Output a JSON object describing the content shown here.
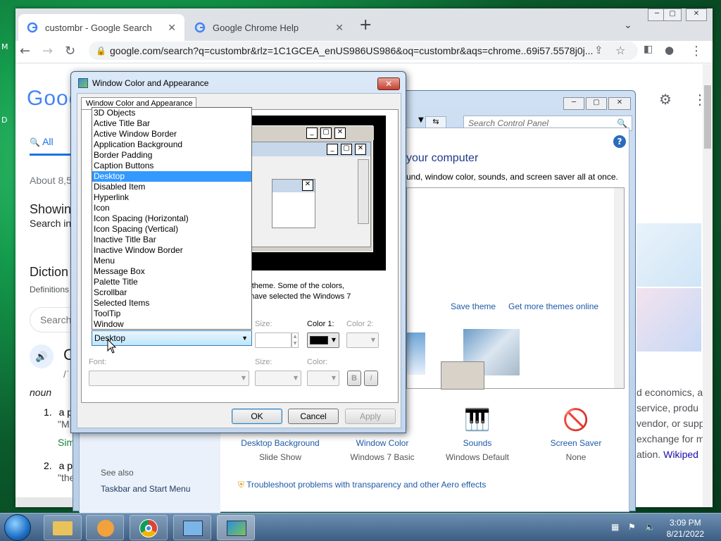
{
  "browser": {
    "tab1_title": "custombr - Google Search",
    "tab2_title": "Google Chrome Help",
    "url": "google.com/search?q=custombr&rlz=1C1GCEA_enUS986US986&oq=custombr&aqs=chrome..69i57.5578j0j...",
    "google": {
      "logo": "Goog",
      "all_tab": "All",
      "about": "About 8,5",
      "showing": "Showin",
      "search_in": "Search in",
      "dictionary": "Diction",
      "definitions": "Definitions",
      "search_box": "Search",
      "word_initial": "C",
      "pron": "/ˈ",
      "pos": "noun",
      "def1_num": "1.",
      "def1": "a p",
      "def1_quote": "\"M",
      "sim": "Sim",
      "def2_num": "2.",
      "def2": "a pe",
      "def2_quote": "\"the",
      "right_lines": [
        "d economics, a",
        "service, produ",
        "vendor, or supp",
        "exchange for m",
        "ation."
      ],
      "wiki": "Wikiped"
    }
  },
  "control_panel": {
    "search_placeholder": "Search Control Panel",
    "heading": "your computer",
    "subheading": "und, window color, sounds, and screen saver all at once.",
    "save_theme": "Save theme",
    "get_more": "Get more themes online",
    "see_also": "See also",
    "taskbar_link": "Taskbar and Start Menu",
    "tiles": [
      {
        "label": "Desktop Background",
        "sub": "Slide Show"
      },
      {
        "label": "Window Color",
        "sub": "Windows 7 Basic"
      },
      {
        "label": "Sounds",
        "sub": "Windows Default"
      },
      {
        "label": "Screen Saver",
        "sub": "None"
      }
    ],
    "troubleshoot": "Troubleshoot problems with transparency and other Aero effects"
  },
  "dialog": {
    "title": "Window Color and Appearance",
    "tab": "Window Color and Appearance",
    "note_line1": "s 7 theme.  Some of the colors,",
    "note_line2": "ou have selected the Windows 7",
    "size_label": "Size:",
    "color1_label": "Color 1:",
    "color2_label": "Color 2:",
    "font_label": "Font:",
    "size2_label": "Size:",
    "color_label": "Color:",
    "bold": "B",
    "italic": "I",
    "ok": "OK",
    "cancel": "Cancel",
    "apply": "Apply",
    "color1_value": "#000000",
    "item_selected": "Desktop",
    "items": [
      "3D Objects",
      "Active Title Bar",
      "Active Window Border",
      "Application Background",
      "Border Padding",
      "Caption Buttons",
      "Desktop",
      "Disabled Item",
      "Hyperlink",
      "Icon",
      "Icon Spacing (Horizontal)",
      "Icon Spacing (Vertical)",
      "Inactive Title Bar",
      "Inactive Window Border",
      "Menu",
      "Message Box",
      "Palette Title",
      "Scrollbar",
      "Selected Items",
      "ToolTip",
      "Window"
    ]
  },
  "taskbar": {
    "time": "3:09 PM",
    "date": "8/21/2022"
  },
  "colors": {
    "accent": "#3399ff",
    "link": "#1e5aa8"
  }
}
